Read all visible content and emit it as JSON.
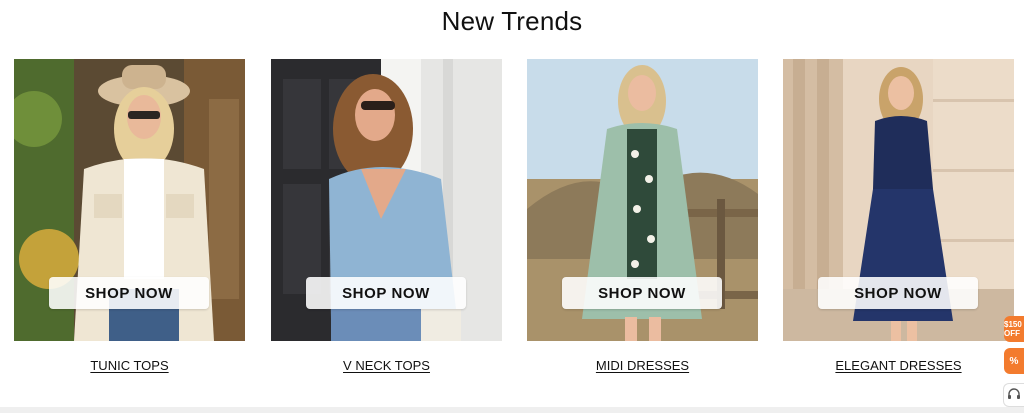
{
  "section": {
    "title": "New Trends"
  },
  "cards": [
    {
      "category": "TUNIC TOPS",
      "button": "SHOP NOW",
      "image_icon": "woman-tunic-top-photo"
    },
    {
      "category": "V NECK TOPS",
      "button": "SHOP NOW",
      "image_icon": "woman-v-neck-top-photo"
    },
    {
      "category": "MIDI DRESSES",
      "button": "SHOP NOW",
      "image_icon": "woman-midi-dress-photo"
    },
    {
      "category": "ELEGANT DRESSES",
      "button": "SHOP NOW",
      "image_icon": "woman-elegant-dress-photo"
    }
  ],
  "side_widgets": {
    "promo_label": "$150 OFF",
    "discount_label": "%",
    "support_icon": "headset-icon"
  },
  "colors": {
    "accent": "#f37b2e",
    "text": "#111111",
    "background": "#ffffff"
  }
}
